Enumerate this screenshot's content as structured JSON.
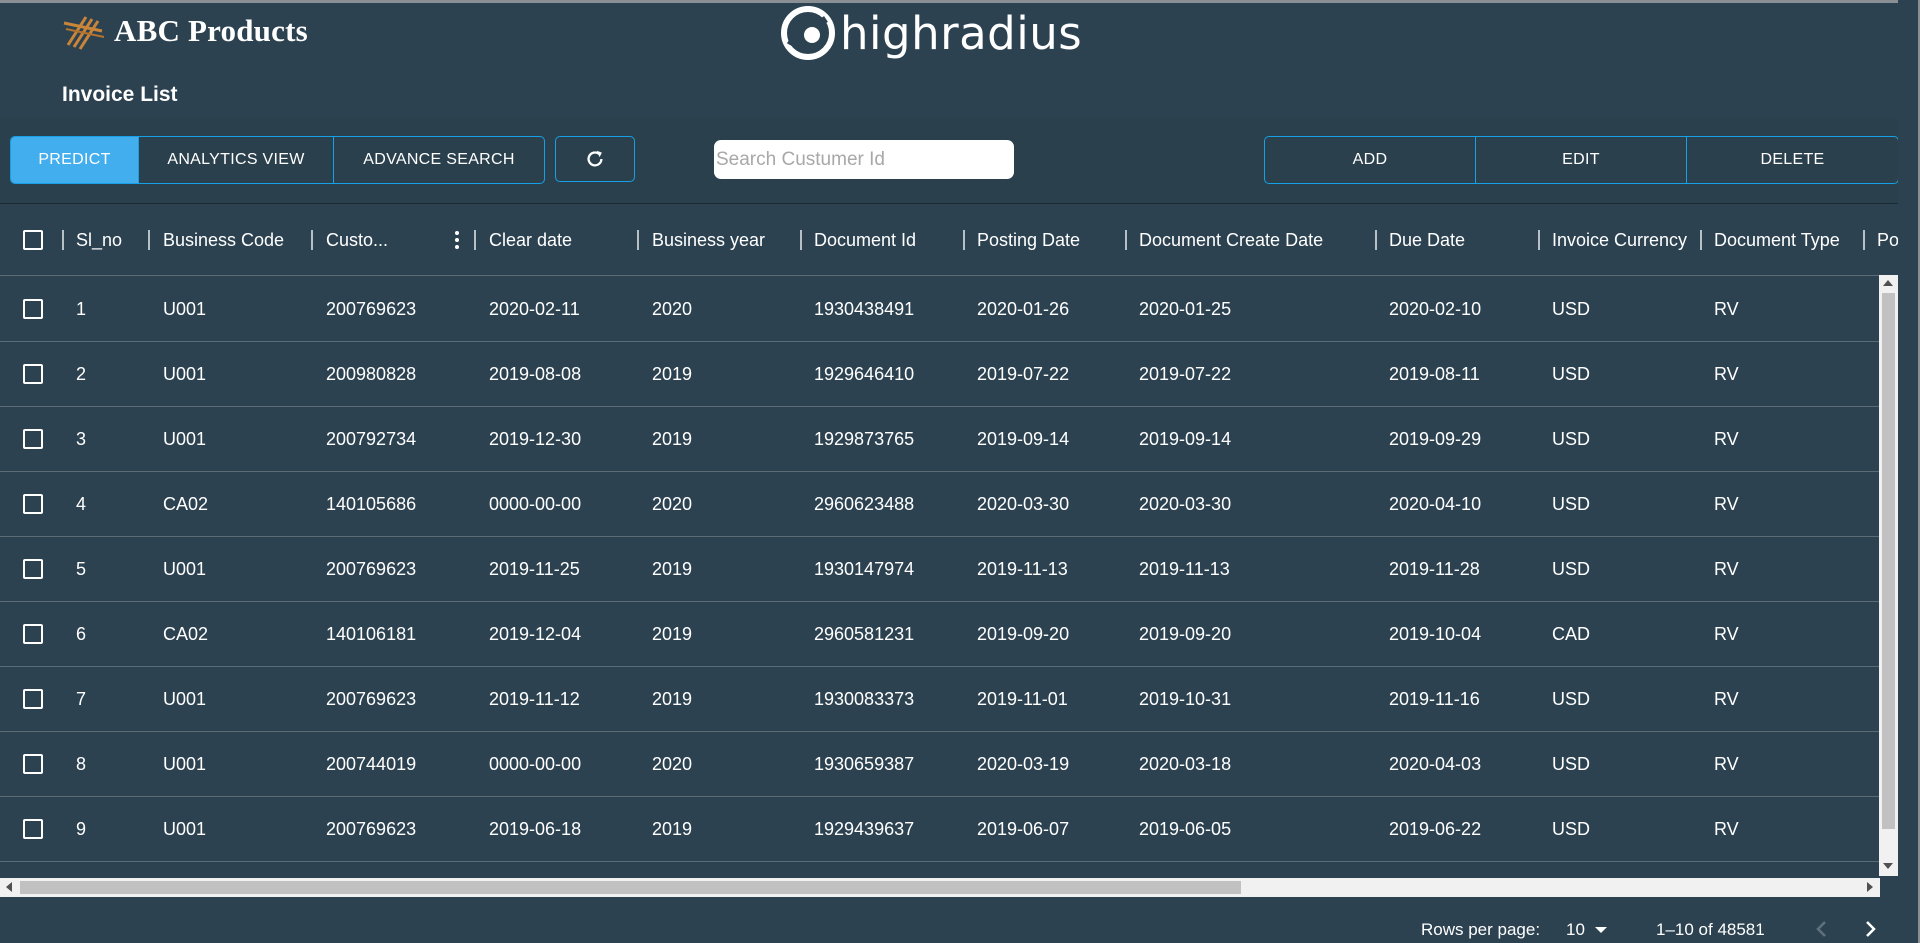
{
  "header": {
    "brand_name": "ABC Products",
    "partner_name": "highradius",
    "page_title": "Invoice List"
  },
  "toolbar": {
    "predict_label": "PREDICT",
    "analytics_label": "ANALYTICS VIEW",
    "advance_search_label": "ADVANCE SEARCH",
    "add_label": "ADD",
    "edit_label": "EDIT",
    "delete_label": "DELETE",
    "search_placeholder": "Search Custumer Id",
    "search_value": ""
  },
  "grid": {
    "columns": [
      "Sl_no",
      "Business Code",
      "Custo...",
      "Clear date",
      "Business year",
      "Document Id",
      "Posting Date",
      "Document Create Date",
      "Due Date",
      "Invoice Currency",
      "Document Type",
      "Po"
    ],
    "rows": [
      [
        "1",
        "U001",
        "200769623",
        "2020-02-11",
        "2020",
        "1930438491",
        "2020-01-26",
        "2020-01-25",
        "2020-02-10",
        "USD",
        "RV"
      ],
      [
        "2",
        "U001",
        "200980828",
        "2019-08-08",
        "2019",
        "1929646410",
        "2019-07-22",
        "2019-07-22",
        "2019-08-11",
        "USD",
        "RV"
      ],
      [
        "3",
        "U001",
        "200792734",
        "2019-12-30",
        "2019",
        "1929873765",
        "2019-09-14",
        "2019-09-14",
        "2019-09-29",
        "USD",
        "RV"
      ],
      [
        "4",
        "CA02",
        "140105686",
        "0000-00-00",
        "2020",
        "2960623488",
        "2020-03-30",
        "2020-03-30",
        "2020-04-10",
        "USD",
        "RV"
      ],
      [
        "5",
        "U001",
        "200769623",
        "2019-11-25",
        "2019",
        "1930147974",
        "2019-11-13",
        "2019-11-13",
        "2019-11-28",
        "USD",
        "RV"
      ],
      [
        "6",
        "CA02",
        "140106181",
        "2019-12-04",
        "2019",
        "2960581231",
        "2019-09-20",
        "2019-09-20",
        "2019-10-04",
        "CAD",
        "RV"
      ],
      [
        "7",
        "U001",
        "200769623",
        "2019-11-12",
        "2019",
        "1930083373",
        "2019-11-01",
        "2019-10-31",
        "2019-11-16",
        "USD",
        "RV"
      ],
      [
        "8",
        "U001",
        "200744019",
        "0000-00-00",
        "2020",
        "1930659387",
        "2020-03-19",
        "2020-03-18",
        "2020-04-03",
        "USD",
        "RV"
      ],
      [
        "9",
        "U001",
        "200769623",
        "2019-06-18",
        "2019",
        "1929439637",
        "2019-06-07",
        "2019-06-05",
        "2019-06-22",
        "USD",
        "RV"
      ]
    ]
  },
  "pagination": {
    "rows_per_page_label": "Rows per page:",
    "rows_per_page_value": "10",
    "range_text": "1–10 of 48581"
  },
  "colors": {
    "background": "#2c4250",
    "accent": "#16a0e6",
    "active_button": "#43aeee",
    "row_divider": "#5b6c77"
  },
  "icons": {
    "brand": "abc-products-logo-icon",
    "partner": "highradius-logo-icon",
    "refresh": "refresh-icon",
    "column_menu": "kebab-menu-icon",
    "rows_dropdown": "caret-down-icon",
    "prev_page": "chevron-left-icon",
    "next_page": "chevron-right-icon"
  }
}
